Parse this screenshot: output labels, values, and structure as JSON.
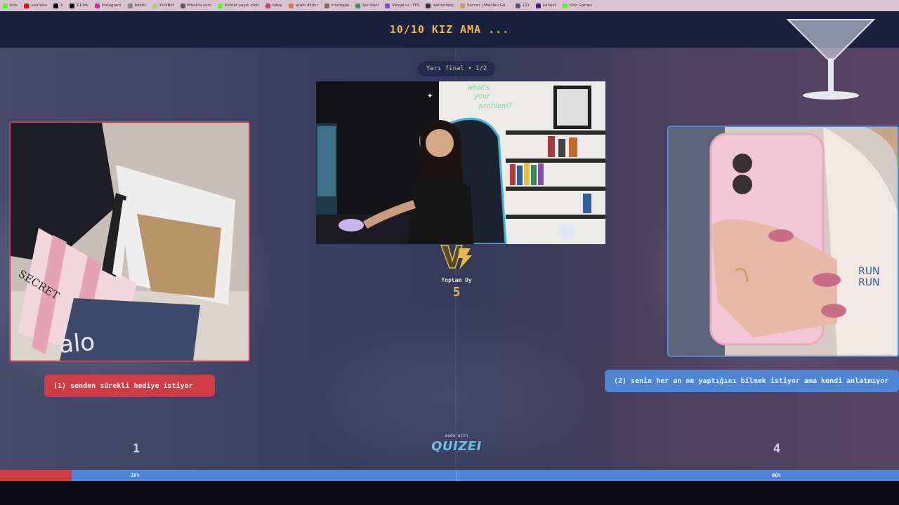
{
  "bookmarks": [
    {
      "label": "Kick",
      "color": "#53fc18"
    },
    {
      "label": "youtube",
      "color": "#ff0000"
    },
    {
      "label": "X",
      "color": "#000000"
    },
    {
      "label": "TikTok",
      "color": "#111111"
    },
    {
      "label": "instagram",
      "color": "#d6249f"
    },
    {
      "label": "bomis",
      "color": "#888888"
    },
    {
      "label": "KickBot",
      "color": "#a2d66a"
    },
    {
      "label": "MissKia.com",
      "color": "#5a5a5a"
    },
    {
      "label": "Kicklet yayın indir",
      "color": "#53fc18"
    },
    {
      "label": "bileşi",
      "color": "#d03a6e"
    },
    {
      "label": "arabı dildur",
      "color": "#e07b39"
    },
    {
      "label": "kinotopia",
      "color": "#8a6e52"
    },
    {
      "label": "fps illahi",
      "color": "#4a8a5e"
    },
    {
      "label": "Venge.io - FPS",
      "color": "#7d4fd6"
    },
    {
      "label": "saklambaç",
      "color": "#333333"
    },
    {
      "label": "Soccer | Martian Ga...",
      "color": "#c9a23d"
    },
    {
      "label": "101",
      "color": "#555577"
    },
    {
      "label": "kahoot",
      "color": "#46178f"
    },
    {
      "label": "Kick Games",
      "color": "#53fc18"
    }
  ],
  "header": {
    "title": "10/10 KIZ AMA ..."
  },
  "round": {
    "label": "Yarı final • 1/2"
  },
  "total": {
    "label": "Toplam Oy",
    "value": "5"
  },
  "left": {
    "label": "(1) senden sürekli hediye istiyor",
    "votes": "1",
    "percent_text": "20%",
    "percent": 20,
    "color": "#d03c46"
  },
  "right": {
    "label": "(2) senin her an ne yaptığını bilmek istiyor ama kendi anlatmıyor",
    "votes": "4",
    "percent_text": "80%",
    "percent": 80,
    "color": "#4f86d6"
  },
  "cam_sign": {
    "line1": "what's",
    "line2": "your",
    "line3": "problem?"
  },
  "bag_text": {
    "secret": "SECRET",
    "alo": "alo"
  },
  "shirt_text": {
    "line1": "RUN",
    "line2": "RUN"
  },
  "footer": {
    "made_with": "made with",
    "brand": "QUIZEI"
  },
  "colors": {
    "accent": "#e8b84a",
    "header_bg": "#1d2140"
  }
}
